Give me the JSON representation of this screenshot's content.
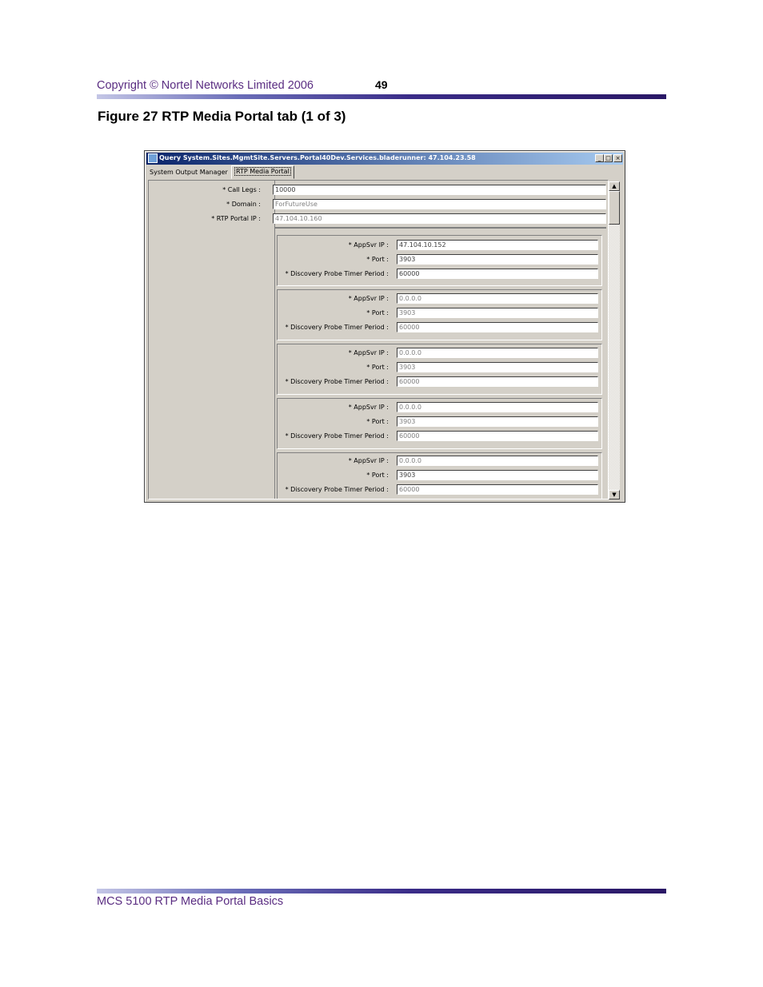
{
  "header": {
    "copyright": "Copyright © Nortel Networks Limited 2006",
    "page_number": "49"
  },
  "figure": {
    "caption": "Figure 27  RTP Media Portal tab (1 of 3)"
  },
  "window": {
    "title": "Query System.Sites.MgmtSite.Servers.Portal40Dev.Services.bladerunner: 47.104.23.58",
    "minimize_glyph": "_",
    "maximize_glyph": "□",
    "close_glyph": "×",
    "tabs": [
      "System Output Manager",
      "RTP Media Portal"
    ],
    "active_tab": "RTP Media Portal",
    "fields": [
      {
        "label": "* Call Legs :",
        "value": "10000"
      },
      {
        "label": "* Domain :",
        "value": "ForFutureUse"
      },
      {
        "label": "* RTP Portal IP :",
        "value": "47.104.10.160"
      }
    ],
    "appsvr_groups": [
      {
        "appsvr_label": "* AppSvr IP :",
        "appsvr_ip": "47.104.10.152",
        "port_label": "* Port :",
        "port": "3903",
        "timer_label": "* Discovery Probe Timer Period :",
        "timer": "60000"
      },
      {
        "appsvr_label": "* AppSvr IP :",
        "appsvr_ip": "0.0.0.0",
        "port_label": "* Port :",
        "port": "3903",
        "timer_label": "* Discovery Probe Timer Period :",
        "timer": "60000"
      },
      {
        "appsvr_label": "* AppSvr IP :",
        "appsvr_ip": "0.0.0.0",
        "port_label": "* Port :",
        "port": "3903",
        "timer_label": "* Discovery Probe Timer Period :",
        "timer": "60000"
      },
      {
        "appsvr_label": "* AppSvr IP :",
        "appsvr_ip": "0.0.0.0",
        "port_label": "* Port :",
        "port": "3903",
        "timer_label": "* Discovery Probe Timer Period :",
        "timer": "60000"
      },
      {
        "appsvr_label": "* AppSvr IP :",
        "appsvr_ip": "0.0.0.0",
        "port_label": "* Port :",
        "port": "3903",
        "timer_label": "* Discovery Probe Timer Period :",
        "timer": "60000"
      }
    ],
    "scroll_up_glyph": "▲",
    "scroll_down_glyph": "▼"
  },
  "footer": {
    "text": "MCS 5100 RTP Media Portal Basics"
  },
  "colors": {
    "header_text": "#5a2d82",
    "title_bar_start": "#0a246a",
    "title_bar_end": "#a6caf0",
    "window_face": "#d4d0c8"
  }
}
